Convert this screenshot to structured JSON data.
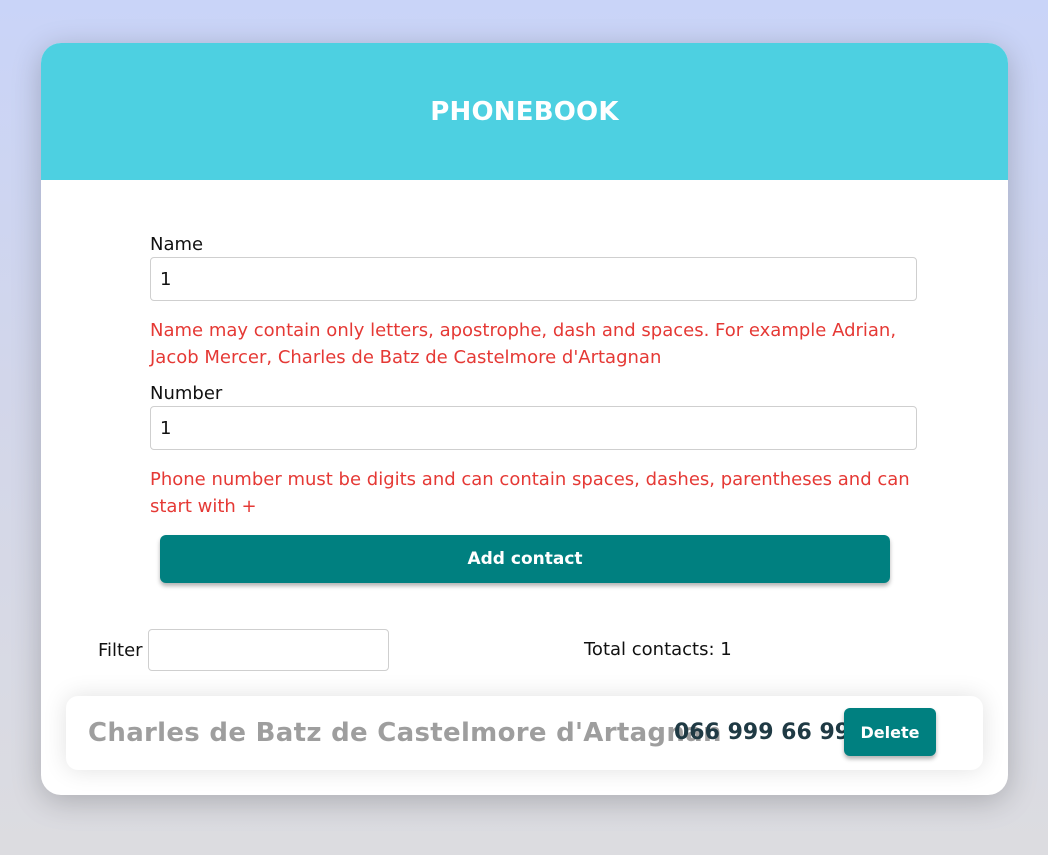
{
  "header": {
    "title": "PHONEBOOK"
  },
  "form": {
    "name_label": "Name",
    "name_value": "1",
    "name_error": "Name may contain only letters, apostrophe, dash and spaces. For example Adrian, Jacob Mercer, Charles de Batz de Castelmore d'Artagnan",
    "number_label": "Number",
    "number_value": "1",
    "number_error": "Phone number must be digits and can contain spaces, dashes, parentheses and can start with +",
    "submit_label": "Add contact"
  },
  "filter": {
    "label": "Filter",
    "value": ""
  },
  "total": "Total contacts: 1",
  "contacts": [
    {
      "name": "Charles de Batz de Castelmore d'Artagnan",
      "number": "066 999 66 99",
      "delete_label": "Delete"
    }
  ],
  "colors": {
    "header": "#4dd0e1",
    "accent": "#008080",
    "error": "#e53935"
  }
}
